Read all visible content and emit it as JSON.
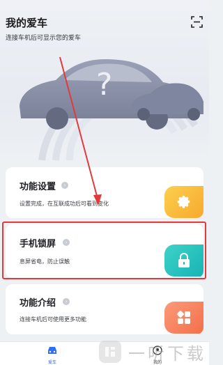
{
  "header": {
    "title": "我的爱车",
    "subtitle": "连接车机后可显示您的爱车"
  },
  "cards": [
    {
      "title": "功能设置",
      "desc": "设置完成，在互联成功后可看到变化",
      "icon": "gear-icon",
      "color_start": "#fdcf4e",
      "color_end": "#f7a92d"
    },
    {
      "title": "手机锁屏",
      "desc": "息屏省电，防止误触",
      "icon": "lock-icon",
      "color_start": "#3fd3c8",
      "color_end": "#18b3b5"
    },
    {
      "title": "功能介绍",
      "desc": "连接车机后可使用更多功能",
      "icon": "apps-icon",
      "color_start": "#fb9a79",
      "color_end": "#f46f4a"
    }
  ],
  "tabbar": {
    "tabs": [
      {
        "label": "爱车",
        "icon": "car-icon",
        "active": true
      },
      {
        "label": "我的",
        "icon": "profile-icon",
        "active": false
      }
    ]
  },
  "watermark": {
    "text": "一听下载"
  },
  "colors": {
    "accent": "#2f6ef5",
    "annotation": "#e23a3a"
  }
}
